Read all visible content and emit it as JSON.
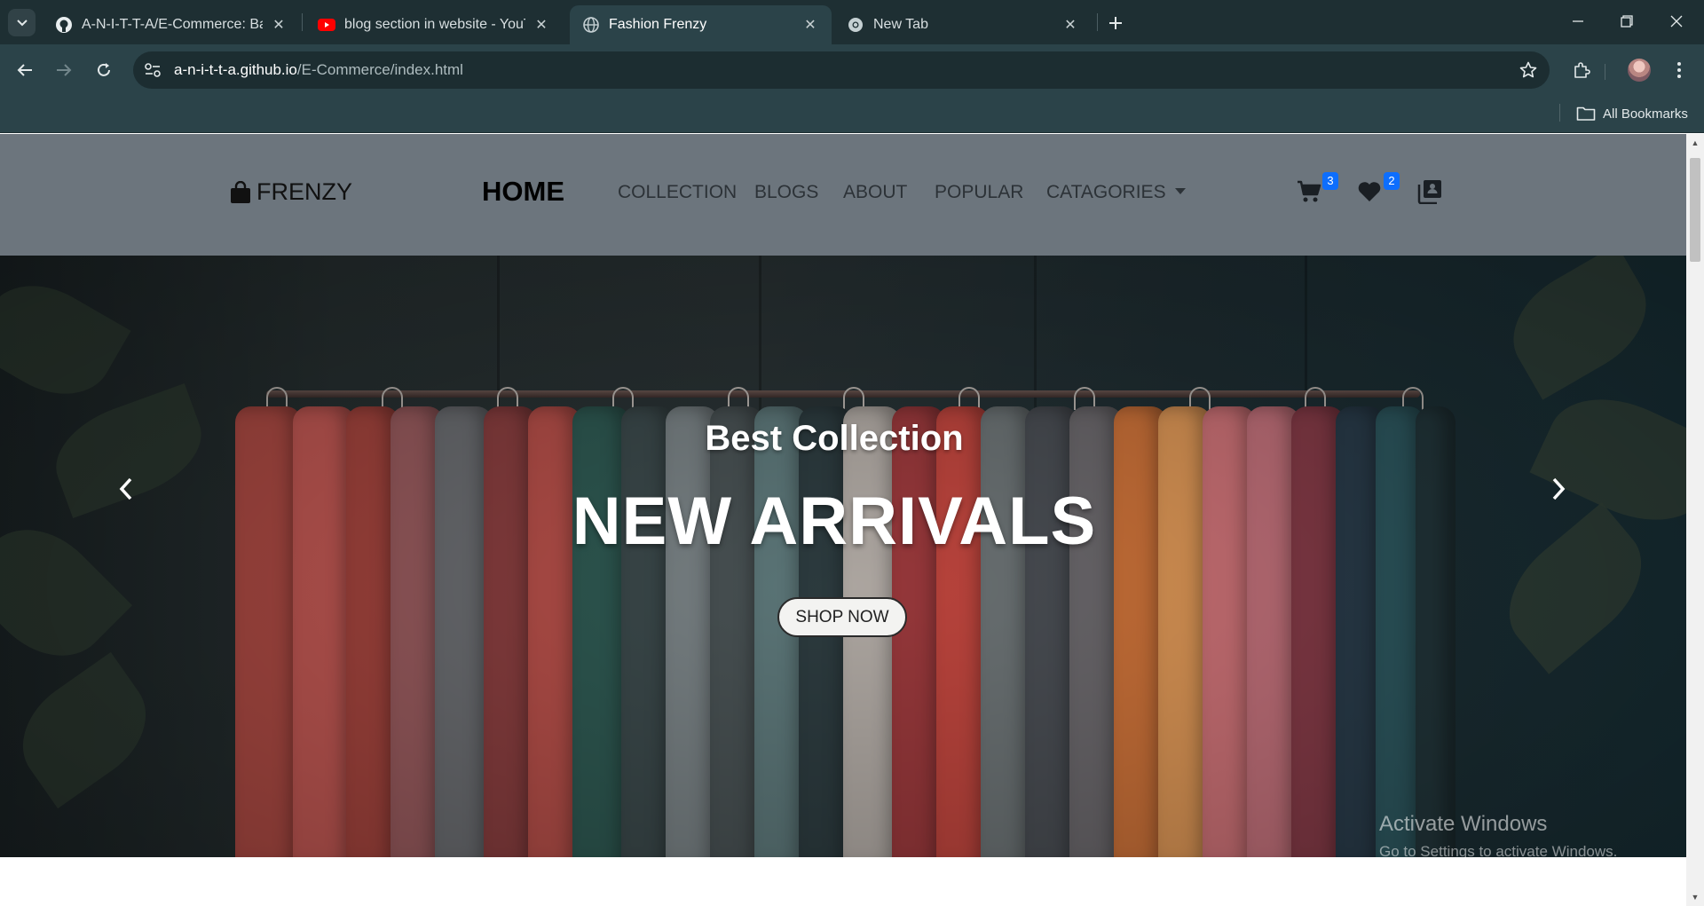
{
  "browser": {
    "tabs": [
      {
        "title": "A-N-I-T-T-A/E-Commerce: Basic",
        "favicon": "github-icon",
        "active": false
      },
      {
        "title": "blog section in website - YouTube",
        "favicon": "youtube-icon",
        "active": false
      },
      {
        "title": "Fashion Frenzy",
        "favicon": "globe-icon",
        "active": true
      },
      {
        "title": "New Tab",
        "favicon": "chrome-icon",
        "active": false
      }
    ],
    "url": {
      "host": "a-n-i-t-t-a.github.io",
      "path": "/E-Commerce/index.html"
    },
    "bookmarks_label": "All Bookmarks"
  },
  "site": {
    "brand": "FRENZY",
    "nav": {
      "home": "HOME",
      "collection": "COLLECTION",
      "blogs": "BLOGS",
      "about": "ABOUT",
      "popular": "POPULAR",
      "categories": "CATAGORIES"
    },
    "cart_count": "3",
    "wishlist_count": "2",
    "badge_color": "#0d6efd",
    "navbar_color": "#6c757d"
  },
  "hero": {
    "subtitle": "Best Collection",
    "title": "NEW ARRIVALS",
    "cta": "SHOP NOW"
  },
  "os_watermark": {
    "line1": "Activate Windows",
    "line2": "Go to Settings to activate Windows."
  }
}
